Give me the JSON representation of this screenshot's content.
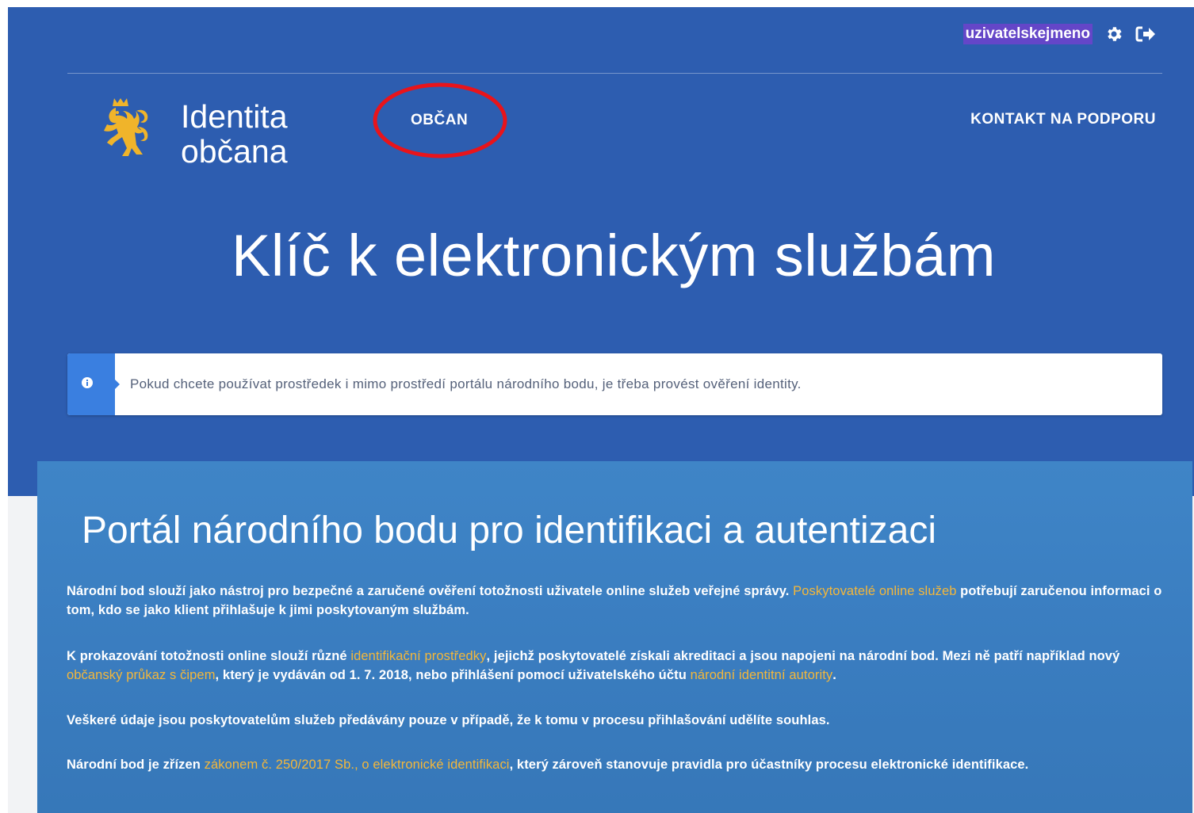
{
  "header": {
    "username": "uzivatelskejmeno",
    "settings_icon": "gear-icon",
    "logout_icon": "logout-icon"
  },
  "brand": {
    "line1": "Identita",
    "line2": "občana",
    "logo_icon": "czech-lion-emblem"
  },
  "nav": {
    "obcan": "OBČAN",
    "kontakt": "KONTAKT NA PODPORU"
  },
  "hero": {
    "title": "Klíč k elektronickým službám"
  },
  "info": {
    "icon": "info-icon",
    "text": "Pokud chcete používat prostředek i mimo prostředí portálu národního bodu, je třeba provést ověření identity."
  },
  "portal": {
    "title": "Portál národního bodu pro identifikaci a autentizaci",
    "p1": {
      "t1": "Národní bod slouží jako nástroj pro bezpečné a zaručené ověření totožnosti uživatele online služeb veřejné správy. ",
      "link1": "Poskytovatelé online služeb",
      "t2": " potřebují zaručenou informaci o tom, kdo se jako klient přihlašuje k jimi poskytovaným službám."
    },
    "p2": {
      "t1": "K prokazování totožnosti online slouží různé ",
      "link1": "identifikační prostředky",
      "t2": ", jejichž poskytovatelé získali akreditaci a jsou napojeni na národní bod. Mezi ně patří například nový ",
      "link2": "občanský průkaz s čipem",
      "t3": ", který je vydáván od 1. 7. 2018, nebo přihlášení pomocí uživatelského účtu ",
      "link3": "národní identitní autority",
      "t4": "."
    },
    "p3": {
      "t1": "Veškeré údaje jsou poskytovatelům služeb předávány pouze v případě, že k tomu v procesu přihlašování udělíte souhlas."
    },
    "p4": {
      "t1": "Národní bod je zřízen ",
      "link1": "zákonem č. 250/2017 Sb., o elektronické identifikaci",
      "t2": ", který zároveň stanovuje pravidla pro účastníky procesu elektronické identifikace."
    }
  },
  "colors": {
    "header_blue": "#2d5db0",
    "card_blue": "#3a7dc0",
    "link_orange": "#f4b73a",
    "info_accent": "#3a7fe0",
    "annotation_red": "#e8141b",
    "username_highlight": "#6446c8"
  }
}
